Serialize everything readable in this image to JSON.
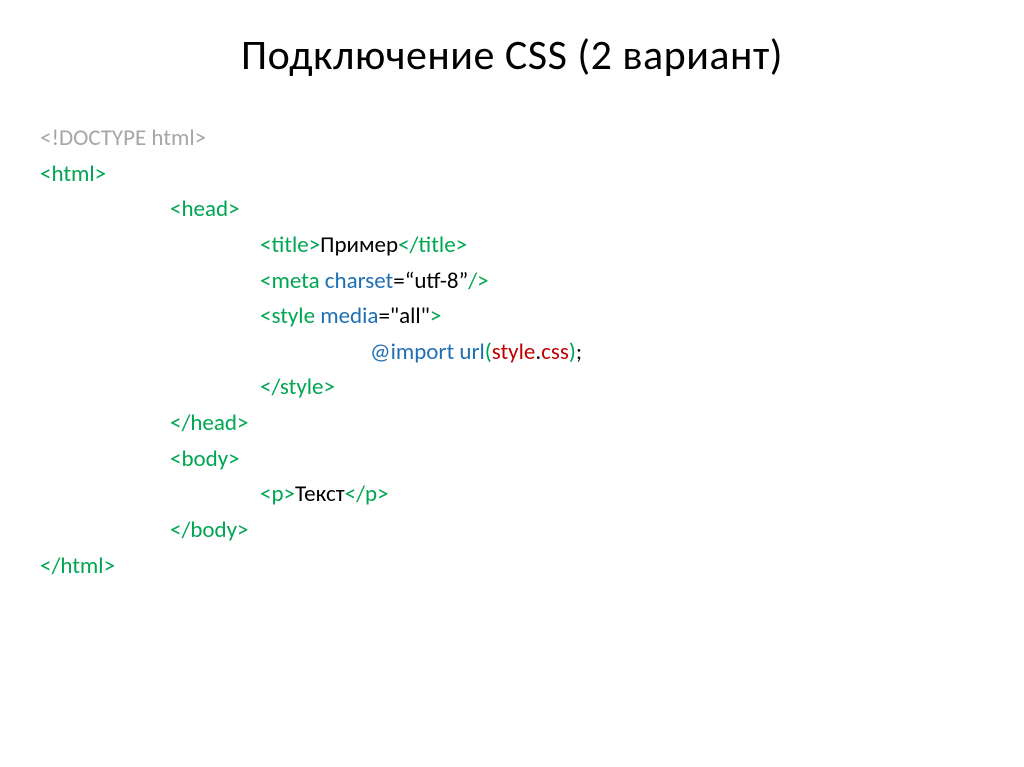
{
  "title": "Подключение CSS (2 вариант)",
  "code": {
    "doctype": "<!DOCTYPE html>",
    "html_open": "<html>",
    "head_open": "<head>",
    "title_open": "<title>",
    "title_text": "Пример",
    "title_close": "</title>",
    "meta_open": "<meta",
    "meta_attr_name": " charset",
    "meta_attr_eq": "=“utf-8”",
    "meta_close": "/>",
    "style_open_tag": "<style",
    "style_attr_name": " media",
    "style_attr_eq": "=\"all\"",
    "style_open_end": ">",
    "import_kw": "@import",
    "url_fn": " url",
    "url_paren_open": "(",
    "style_file": "style",
    "dot": ".",
    "css_ext": "css",
    "url_paren_close": ")",
    "semicolon": ";",
    "style_close": "</style>",
    "head_close": "</head>",
    "body_open": "<body>",
    "p_open": "<p>",
    "p_text": "Текст",
    "p_close": "</p>",
    "body_close": "</body>",
    "html_close": "</html>"
  }
}
